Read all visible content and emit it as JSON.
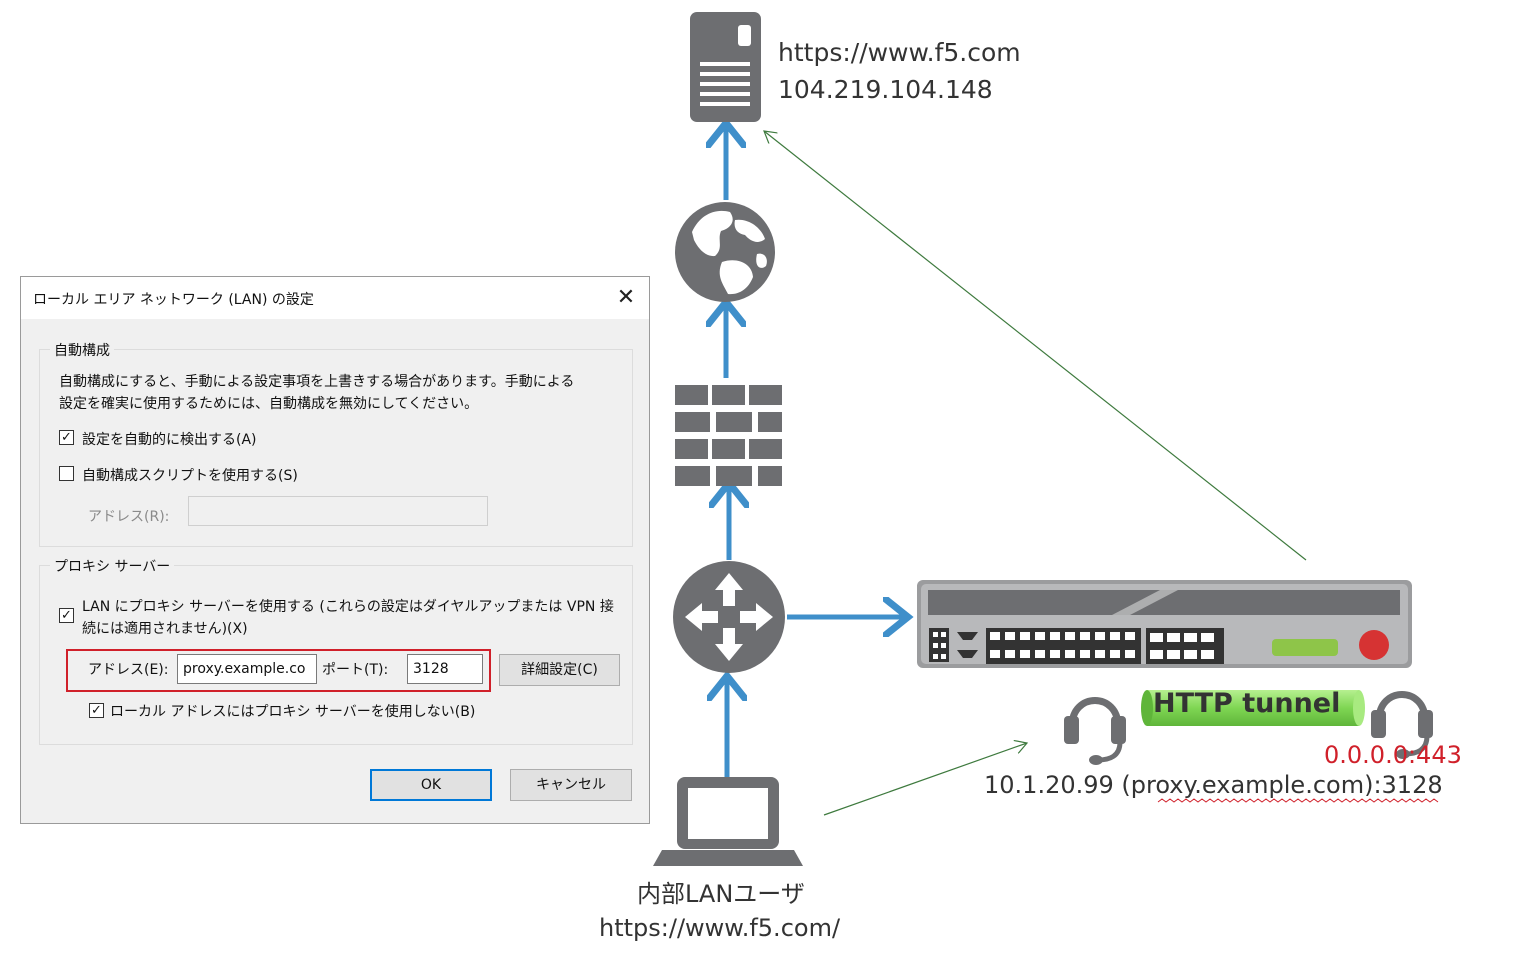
{
  "server": {
    "url": "https://www.f5.com",
    "ip": "104.219.104.148"
  },
  "user": {
    "label": "内部LANユーザ",
    "url": "https://www.f5.com/"
  },
  "proxy": {
    "tunnel_label": "HTTP tunnel",
    "listen": "0.0.0.0:443",
    "address": "10.1.20.99 (proxy.example.com):3128"
  },
  "dialog": {
    "title": "ローカル エリア ネットワーク (LAN) の設定",
    "close_glyph": "✕",
    "auto_config": {
      "legend": "自動構成",
      "desc_line1": "自動構成にすると、手動による設定事項を上書きする場合があります。手動による",
      "desc_line2": "設定を確実に使用するためには、自動構成を無効にしてください。",
      "auto_detect": {
        "label": "設定を自動的に検出する(A)",
        "checked": true
      },
      "use_script": {
        "label": "自動構成スクリプトを使用する(S)",
        "checked": false
      },
      "address_label": "アドレス(R):",
      "address_value": ""
    },
    "proxy_server": {
      "legend": "プロキシ サーバー",
      "use_proxy_line1": "LAN にプロキシ サーバーを使用する (これらの設定はダイヤルアップまたは VPN 接",
      "use_proxy_line2": "続には適用されません)(X)",
      "use_proxy_checked": true,
      "address_label": "アドレス(E):",
      "address_value": "proxy.example.co",
      "port_label": "ポート(T):",
      "port_value": "3128",
      "advanced_label": "詳細設定(C)",
      "bypass_local": {
        "label": "ローカル アドレスにはプロキシ サーバーを使用しない(B)",
        "checked": true
      }
    },
    "ok_label": "OK",
    "cancel_label": "キャンセル"
  },
  "icons": {
    "server": "server-icon",
    "globe": "globe-icon",
    "firewall": "firewall-icon",
    "router": "router-icon",
    "appliance": "proxy-appliance-icon",
    "laptop": "laptop-icon",
    "headset": "headset-icon"
  },
  "colors": {
    "icon_gray": "#6d6e71",
    "arrow_blue": "#3f8fca",
    "thin_line_green": "#3e7a3e",
    "tunnel_green": "#8fdc6a",
    "listen_red": "#d0202a",
    "highlight_red": "#d0202a",
    "led_red": "#d63333",
    "led_green": "#8ec549"
  }
}
